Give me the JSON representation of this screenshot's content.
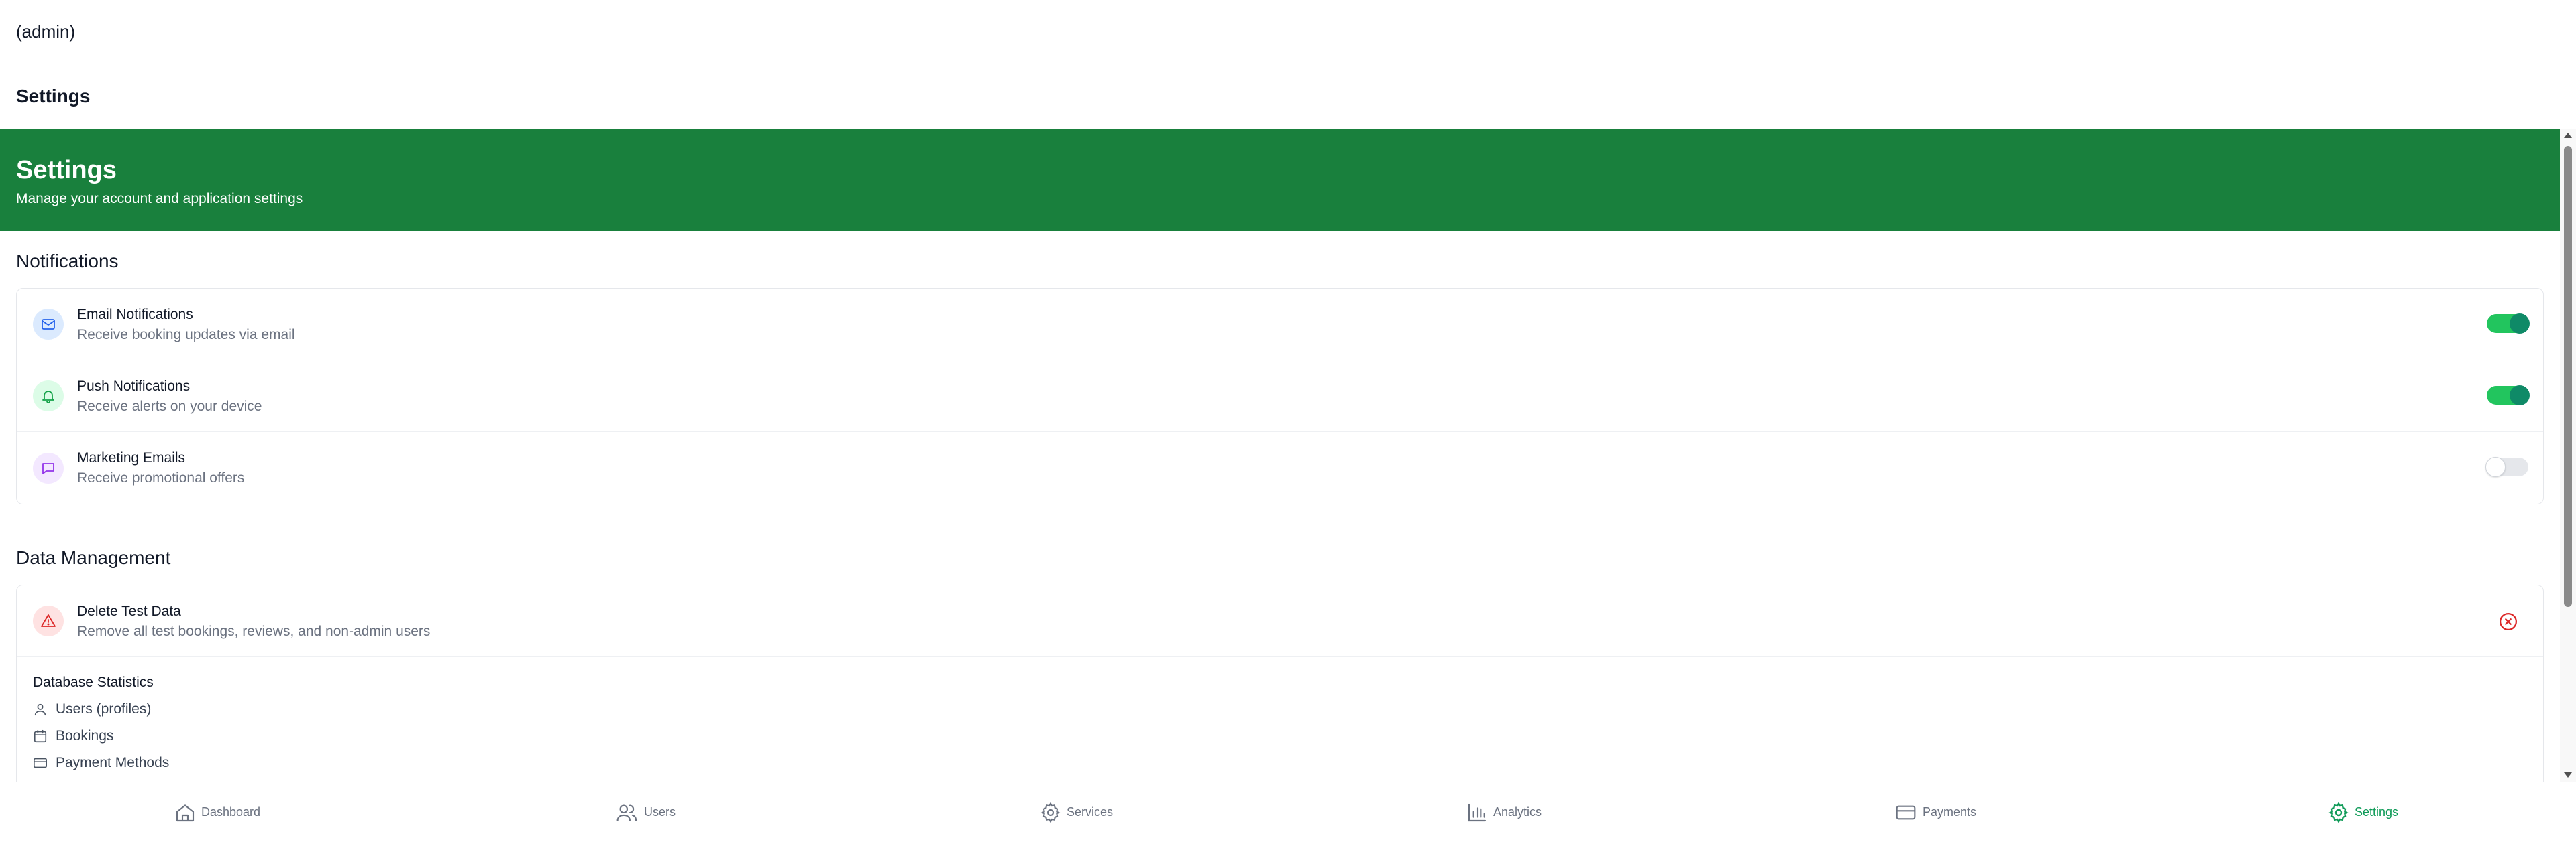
{
  "header": {
    "user_label": "(admin)",
    "page_title": "Settings"
  },
  "hero": {
    "title": "Settings",
    "subtitle": "Manage your account and application settings"
  },
  "notifications": {
    "title": "Notifications",
    "items": [
      {
        "title": "Email Notifications",
        "subtitle": "Receive booking updates via email",
        "enabled": true,
        "icon": "mail-icon"
      },
      {
        "title": "Push Notifications",
        "subtitle": "Receive alerts on your device",
        "enabled": true,
        "icon": "bell-icon"
      },
      {
        "title": "Marketing Emails",
        "subtitle": "Receive promotional offers",
        "enabled": false,
        "icon": "message-icon"
      }
    ]
  },
  "data_management": {
    "title": "Data Management",
    "delete": {
      "title": "Delete Test Data",
      "subtitle": "Remove all test bookings, reviews, and non-admin users"
    },
    "stats_title": "Database Statistics",
    "stats": [
      {
        "label": "Users (profiles)",
        "icon": "user-icon"
      },
      {
        "label": "Bookings",
        "icon": "calendar-icon"
      },
      {
        "label": "Payment Methods",
        "icon": "credit-card-icon"
      }
    ]
  },
  "nav": {
    "items": [
      {
        "label": "Dashboard",
        "icon": "home-icon"
      },
      {
        "label": "Users",
        "icon": "users-icon"
      },
      {
        "label": "Services",
        "icon": "gear-icon"
      },
      {
        "label": "Analytics",
        "icon": "bar-chart-icon"
      },
      {
        "label": "Payments",
        "icon": "credit-card-icon"
      },
      {
        "label": "Settings",
        "icon": "gear-icon",
        "active": true
      }
    ]
  },
  "colors": {
    "brand": "#19803d",
    "toggle_on": "#22c55e",
    "active_nav": "#0f9b58",
    "danger": "#dc2626"
  }
}
